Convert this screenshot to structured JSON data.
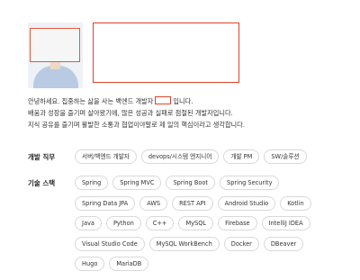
{
  "profile": {
    "intro_part1": "안녕하세요. 집중하는 삶을 사는 백엔드 개발자",
    "intro_part2": "입니다.",
    "intro_line2": "배움과 성장을 즐기며 살아왔기에, 많은 성공과 실패로 점철된 개발자입니다.",
    "intro_line3": "지식 공유를 즐기며 활발한 소통과 협업이야말로 제 일의 핵심이라고 생각합니다."
  },
  "sections": {
    "job": {
      "label": "개발 직무",
      "chips": [
        "서버/백엔드 개발자",
        "devops/시스템 엔지니어",
        "개발 PM",
        "SW/솔루션"
      ]
    },
    "skills": {
      "label": "기술 스택",
      "rows": [
        [
          "Spring",
          "Spring MVC",
          "Spring Boot",
          "Spring Security"
        ],
        [
          "Spring Data JPA",
          "AWS",
          "REST API",
          "Android Studio",
          "Kotlin"
        ],
        [
          "Java",
          "Python",
          "C++",
          "MySQL",
          "Firebase",
          "IntelliJ IDEA"
        ],
        [
          "Visual Studio Code",
          "MySQL WorkBench",
          "Docker",
          "DBeaver"
        ],
        [
          "Hugo",
          "MariaDB"
        ]
      ]
    }
  },
  "colors": {
    "redaction": "#e0442a",
    "chip_border": "#d9d9d9"
  }
}
